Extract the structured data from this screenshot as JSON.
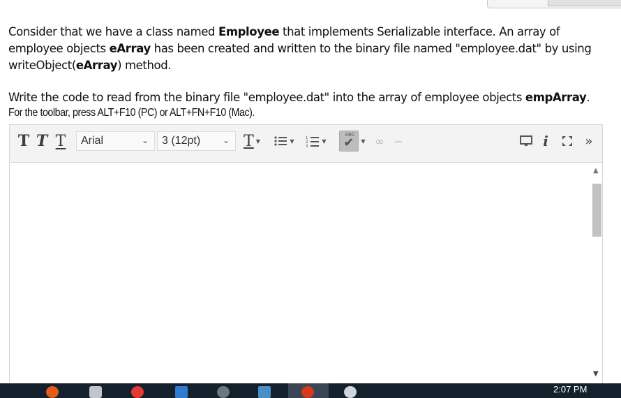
{
  "question": {
    "p1_before_class": "Consider that we have a class named ",
    "class_name": "Employee",
    "p1_middle": " that implements Serializable interface. An array of employee objects ",
    "array_name": "eArray",
    "p1_after_array": " has been created and written to the binary file named \"employee.dat\" by using writeObject(",
    "array_name_2": "eArray",
    "p1_end": ") method.",
    "p2_before": "Write the code to read from the binary file \"employee.dat\" into the array of employee objects ",
    "target_array": "empArray",
    "p2_end": "."
  },
  "toolbar_hint": "For the toolbar, press ALT+F10 (PC) or ALT+FN+F10 (Mac).",
  "toolbar": {
    "bold_glyph": "T",
    "italic_glyph": "T",
    "underline_glyph": "T",
    "font_family": "Arial",
    "font_size": "3 (12pt)",
    "text_color_glyph": "T",
    "spellcheck_abc": "ABC"
  },
  "editor": {
    "content": ""
  },
  "taskbar": {
    "clock": "2:07 PM"
  },
  "colors": {
    "toolbar_bg": "#f3f3f3",
    "taskbar_bg": "#14202c",
    "spell_active": "#bdbdbd"
  },
  "icons": [
    "bold-icon",
    "italic-icon",
    "underline-icon",
    "text-color-icon",
    "bullet-list-icon",
    "numbered-list-icon",
    "spellcheck-icon",
    "link-icon",
    "unlink-icon",
    "preview-icon",
    "info-icon",
    "fullscreen-icon",
    "more-icon"
  ]
}
